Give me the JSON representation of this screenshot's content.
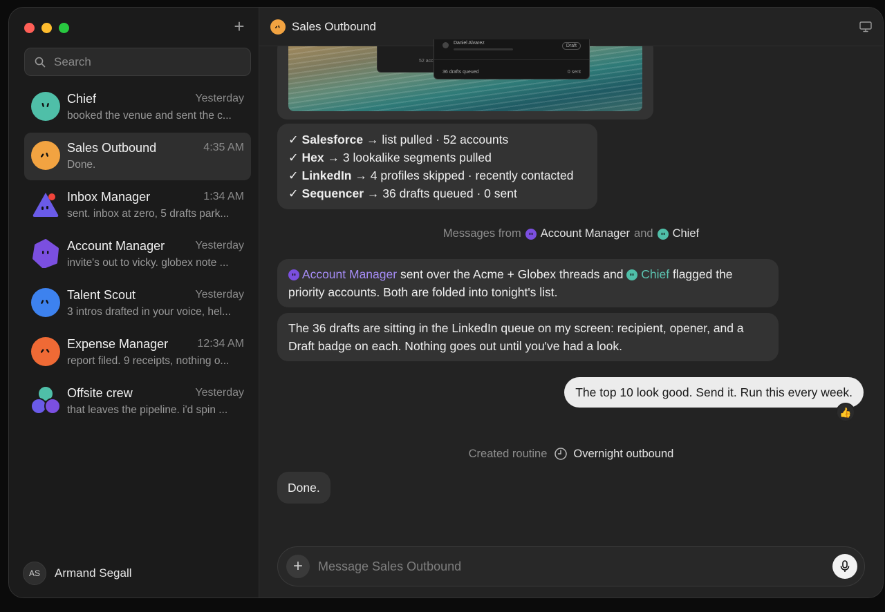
{
  "sidebar": {
    "search_placeholder": "Search",
    "conversations": [
      {
        "name": "Chief",
        "time": "Yesterday",
        "preview": "booked the venue and sent the c...",
        "color": "#4fbfa8"
      },
      {
        "name": "Sales Outbound",
        "time": "4:35 AM",
        "preview": "Done.",
        "color": "#f2a341"
      },
      {
        "name": "Inbox Manager",
        "time": "1:34 AM",
        "preview": "sent. inbox at zero, 5 drafts park...",
        "color": "#6a5be8"
      },
      {
        "name": "Account Manager",
        "time": "Yesterday",
        "preview": "invite's out to vicky. globex note ...",
        "color": "#7b4fe0"
      },
      {
        "name": "Talent Scout",
        "time": "Yesterday",
        "preview": "3 intros drafted in your voice, hel...",
        "color": "#3d82ef"
      },
      {
        "name": "Expense Manager",
        "time": "12:34 AM",
        "preview": "report filed. 9 receipts, nothing o...",
        "color": "#ef6a35"
      },
      {
        "name": "Offsite crew",
        "time": "Yesterday",
        "preview": "that leaves the pipeline. i'd spin ...",
        "color": "#7a5ce6"
      }
    ],
    "user": {
      "initials": "AS",
      "name": "Armand Segall"
    }
  },
  "header": {
    "title": "Sales Outbound"
  },
  "screenshot_preview": {
    "contact": "Daniel Alvarez",
    "badge": "Draft",
    "queued": "36 drafts queued",
    "sent": "0 sent",
    "accounts": "52 acc"
  },
  "steps": [
    {
      "check": "✓",
      "tool": "Salesforce",
      "detail": "→ list pulled · 52 accounts"
    },
    {
      "check": "✓",
      "tool": "Hex",
      "detail": "→ 3 lookalike segments pulled"
    },
    {
      "check": "✓",
      "tool": "LinkedIn",
      "detail": "→ 4 profiles skipped · recently contacted"
    },
    {
      "check": "✓",
      "tool": "Sequencer",
      "detail": "→ 36 drafts queued · 0 sent"
    }
  ],
  "messages_from": {
    "prefix": "Messages from",
    "agent1": "Account Manager",
    "joiner": "and",
    "agent2": "Chief"
  },
  "msg1": {
    "agent1": "Account Manager",
    "part1": "sent over the Acme + Globex threads and",
    "agent2": "Chief",
    "part2": "flagged the priority accounts. Both are folded into tonight's list."
  },
  "msg2": {
    "text": "The 36 drafts are sitting in the LinkedIn queue on my screen: recipient, opener, and a Draft badge on each. Nothing goes out until you've had a look."
  },
  "user_msg": {
    "text": "The top 10 look good. Send it. Run this every week.",
    "reaction": "👍"
  },
  "routine": {
    "prefix": "Created routine",
    "name": "Overnight outbound"
  },
  "final_msg": {
    "text": "Done."
  },
  "composer": {
    "placeholder": "Message Sales Outbound"
  }
}
